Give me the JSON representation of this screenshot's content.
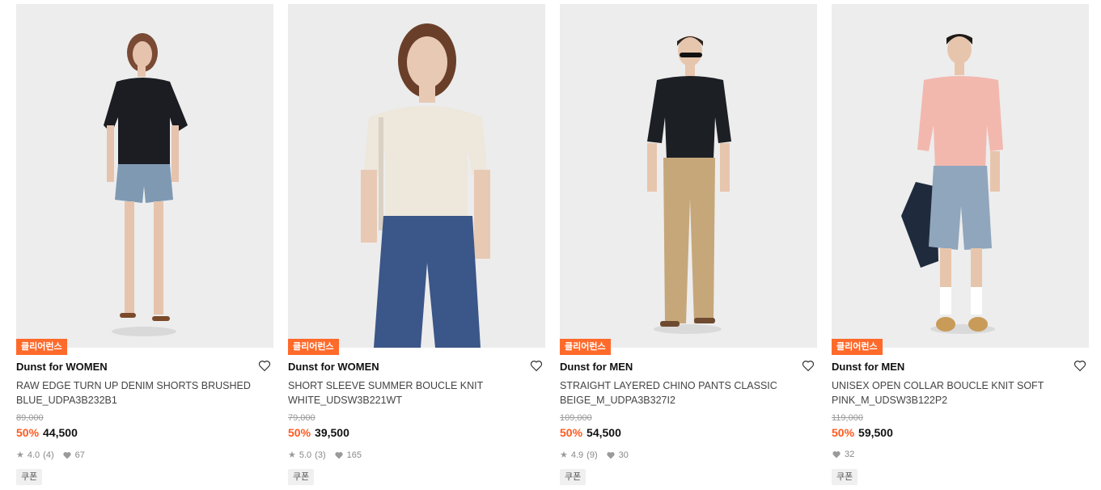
{
  "products": [
    {
      "badge": "클리어런스",
      "brand": "Dunst for WOMEN",
      "title": "RAW EDGE TURN UP DENIM SHORTS BRUSHED BLUE_UDPA3B232B1",
      "original_price": "89,000",
      "discount": "50%",
      "price": "44,500",
      "rating": "4.0",
      "reviews": "(4)",
      "likes": "67",
      "coupon": "쿠폰",
      "colors": {
        "top": "#1b1d22",
        "bottom": "#7f99b3",
        "skin": "#e6c3ad"
      }
    },
    {
      "badge": "클리어런스",
      "brand": "Dunst for WOMEN",
      "title": "SHORT SLEEVE SUMMER BOUCLE KNIT WHITE_UDSW3B221WT",
      "original_price": "79,000",
      "discount": "50%",
      "price": "39,500",
      "rating": "5.0",
      "reviews": "(3)",
      "likes": "165",
      "coupon": "쿠폰",
      "colors": {
        "top": "#ede7dc",
        "bottom": "#3b5688",
        "skin": "#e8c9b4"
      }
    },
    {
      "badge": "클리어런스",
      "brand": "Dunst for MEN",
      "title": "STRAIGHT LAYERED CHINO PANTS CLASSIC BEIGE_M_UDPA3B327I2",
      "original_price": "109,000",
      "discount": "50%",
      "price": "54,500",
      "rating": "4.9",
      "reviews": "(9)",
      "likes": "30",
      "coupon": "쿠폰",
      "colors": {
        "top": "#1c1f24",
        "bottom": "#c6a77a",
        "skin": "#e7c6ae"
      }
    },
    {
      "badge": "클리어런스",
      "brand": "Dunst for MEN",
      "title": "UNISEX OPEN COLLAR BOUCLE KNIT SOFT PINK_M_UDSW3B122P2",
      "original_price": "119,000",
      "discount": "50%",
      "price": "59,500",
      "rating": "",
      "reviews": "",
      "likes": "32",
      "coupon": "쿠폰",
      "colors": {
        "top": "#f2b8ae",
        "bottom": "#8fa6bd",
        "skin": "#e7c5ac"
      }
    }
  ]
}
